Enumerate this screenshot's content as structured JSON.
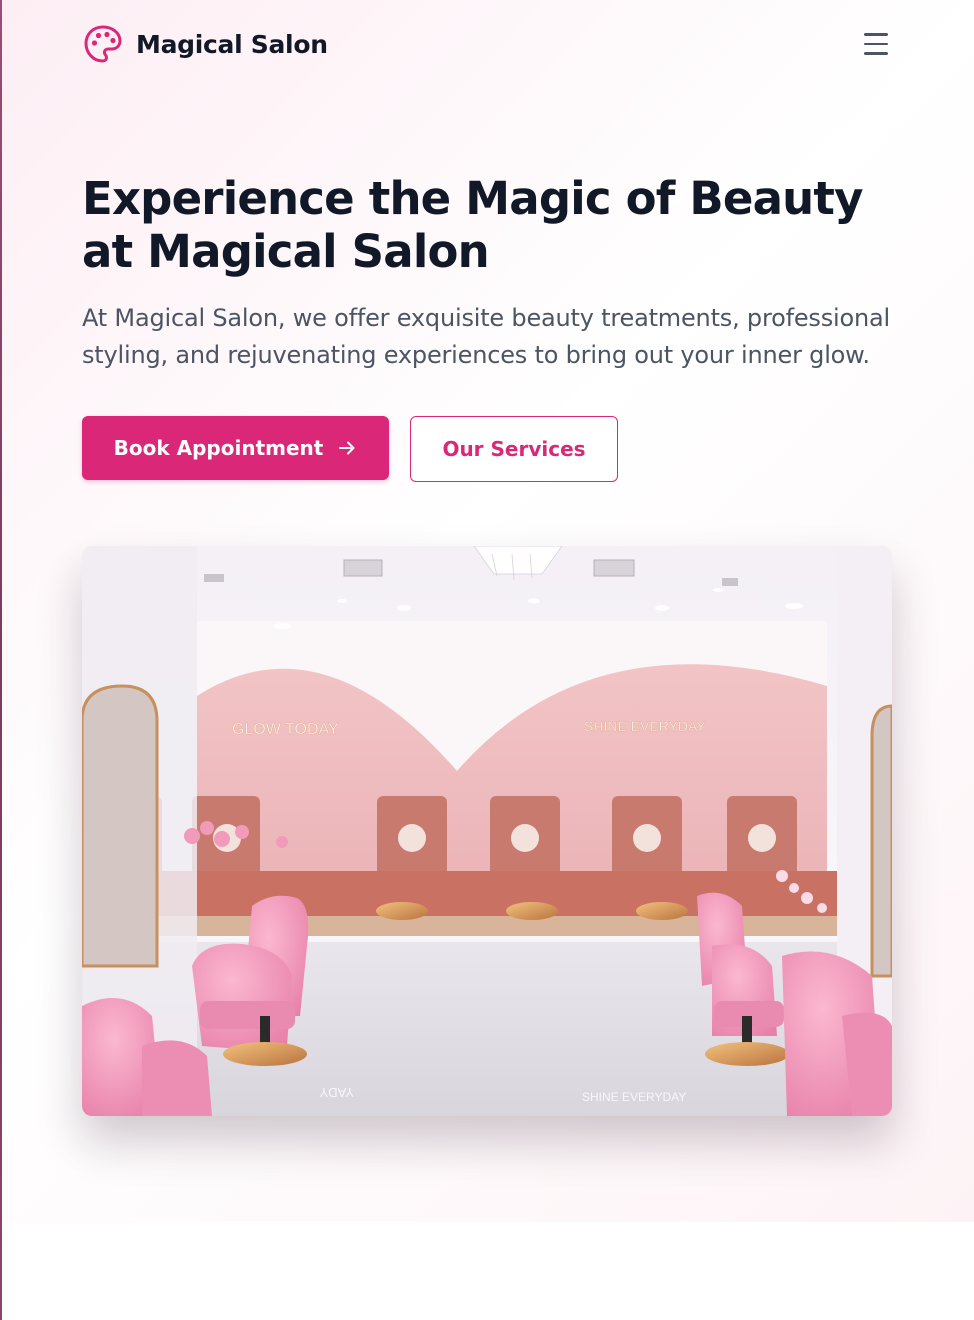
{
  "header": {
    "brand_name": "Magical Salon",
    "logo_icon": "palette-icon",
    "menu_icon": "hamburger-menu-icon"
  },
  "hero": {
    "title": "Experience the Magic of Beauty at Magical Salon",
    "description": "At Magical Salon, we offer exquisite beauty treatments, professional styling, and rejuvenating experiences to bring out your inner glow.",
    "primary_button": {
      "label": "Book Appointment",
      "icon": "arrow-right-icon"
    },
    "secondary_button": {
      "label": "Our Services"
    },
    "image": {
      "wall_sign_left": "GLOW TODAY",
      "wall_sign_right": "SHINE EVERYDAY"
    }
  },
  "colors": {
    "accent": "#db2777",
    "heading": "#111827",
    "body_text": "#4b5563",
    "hero_background": "#fdeef4"
  }
}
